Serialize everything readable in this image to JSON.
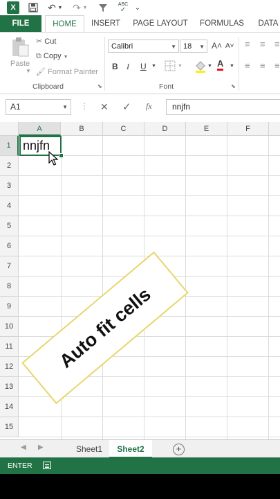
{
  "qat": {
    "app_icon": "X",
    "save_icon": "save-icon",
    "undo_icon": "↶",
    "redo_icon": "↷",
    "filter_icon": "▼",
    "spelling_label": "ABC",
    "customize_icon": "⌄"
  },
  "ribbon_tabs": [
    "FILE",
    "HOME",
    "INSERT",
    "PAGE LAYOUT",
    "FORMULAS",
    "DATA"
  ],
  "clipboard": {
    "paste_label": "Paste",
    "cut_label": "Cut",
    "copy_label": "Copy",
    "format_painter_label": "Format Painter",
    "group_label": "Clipboard"
  },
  "font": {
    "font_name": "Calibri",
    "font_size": "18",
    "bold": "B",
    "italic": "I",
    "underline": "U",
    "grow": "A˄",
    "shrink": "A˅",
    "font_color_letter": "A",
    "font_color_hex": "#e81123",
    "group_label": "Font"
  },
  "formula_bar": {
    "name_box": "A1",
    "cancel_icon": "✕",
    "enter_icon": "✓",
    "fx_label": "fx",
    "content": "nnjfn"
  },
  "grid": {
    "columns": [
      "A",
      "B",
      "C",
      "D",
      "E",
      "F"
    ],
    "rows": [
      "1",
      "2",
      "3",
      "4",
      "5",
      "6",
      "7",
      "8",
      "9",
      "10",
      "11",
      "12",
      "13",
      "14",
      "15"
    ],
    "cell_a1": "nnjfn"
  },
  "overlay": {
    "banner_text": "Auto fit cells"
  },
  "sheets": [
    "Sheet1",
    "Sheet2"
  ],
  "active_sheet": "Sheet2",
  "status_bar": {
    "mode": "ENTER"
  },
  "colors": {
    "excel_green": "#217346",
    "banner_border": "#e8d66b"
  }
}
